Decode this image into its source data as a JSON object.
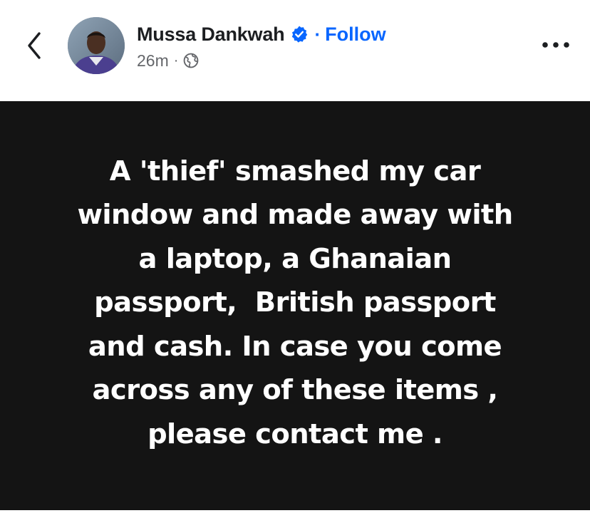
{
  "header": {
    "author_name": "Mussa Dankwah",
    "separator": "·",
    "follow_label": "Follow",
    "timestamp": "26m",
    "meta_separator": "·",
    "icons": {
      "back": "chevron-left-icon",
      "verified": "verified-badge-icon",
      "audience": "globe-icon",
      "more": "more-options-icon"
    }
  },
  "post": {
    "text": "A 'thief' smashed my car\nwindow and made away with\na laptop, a Ghanaian\npassport,  British passport\nand cash. In case you come\nacross any of these items ,\nplease contact me ."
  },
  "colors": {
    "accent": "#0866ff",
    "post_background": "#141414",
    "post_text": "#ffffff",
    "name_text": "#1c1e21",
    "meta_text": "#65676b"
  }
}
